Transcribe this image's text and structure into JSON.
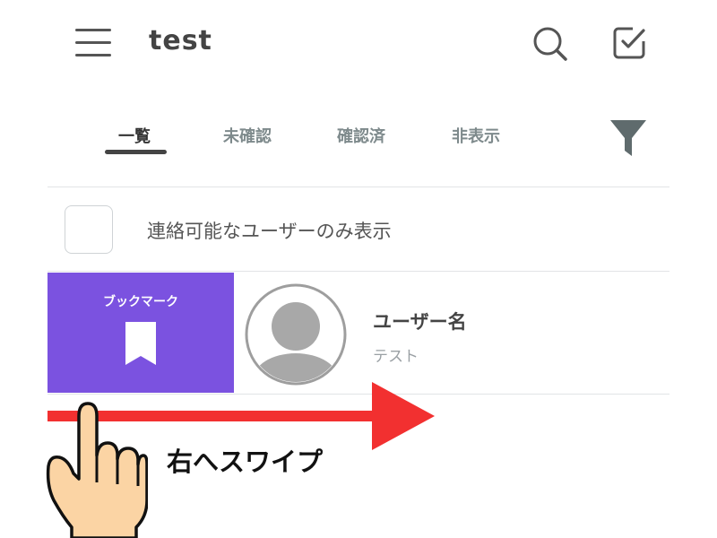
{
  "header": {
    "title": "test",
    "icons": {
      "menu": "menu-icon",
      "search": "search-icon",
      "edit": "check-square-icon"
    }
  },
  "tabs": [
    {
      "label": "一覧",
      "active": true
    },
    {
      "label": "未確認",
      "active": false
    },
    {
      "label": "確認済",
      "active": false
    },
    {
      "label": "非表示",
      "active": false
    }
  ],
  "filter": {
    "icon": "filter-icon"
  },
  "contact_filter": {
    "label": "連絡可能なユーザーのみ表示",
    "checked": false
  },
  "list": {
    "items": [
      {
        "name": "ユーザー名",
        "subtitle": "テスト",
        "swipe_action": {
          "label": "ブックマーク",
          "icon": "bookmark-icon"
        }
      }
    ]
  },
  "annotation": {
    "text": "右へスワイプ",
    "arrow_direction": "right"
  },
  "colors": {
    "accent_purple": "#7b52e0",
    "arrow_red": "#f23030",
    "tab_inactive": "#7e8a8c",
    "filter_icon": "#5f6b6d"
  }
}
